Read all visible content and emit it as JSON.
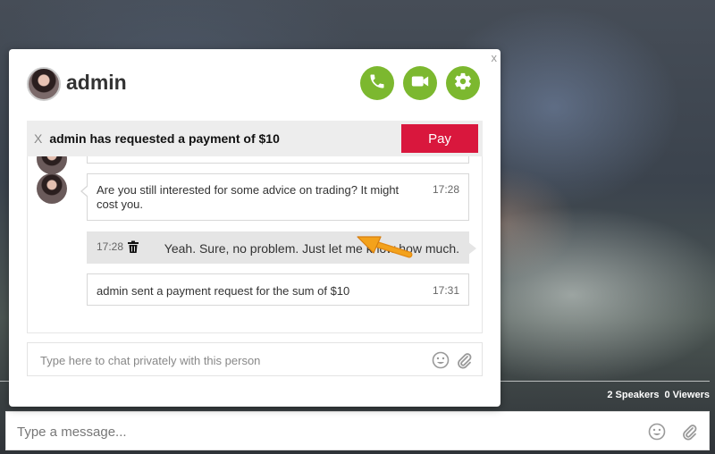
{
  "dialog": {
    "close_label": "x",
    "user_name": "admin",
    "icons": {
      "call": "phone-icon",
      "video": "video-camera-icon",
      "settings": "gear-icon"
    },
    "accent_color": "#7cb82f"
  },
  "payment_banner": {
    "dismiss_label": "X",
    "text": "admin has requested a payment of $10",
    "pay_label": "Pay",
    "pay_color": "#d9173d"
  },
  "messages": [
    {
      "direction": "incoming",
      "text": "Are you still interested for some advice on trading? It might cost you.",
      "time": "17:28"
    },
    {
      "direction": "outgoing",
      "text": "Yeah. Sure, no problem. Just let me know how much.",
      "time": "17:28"
    },
    {
      "direction": "incoming",
      "text": "admin sent a payment request for the sum of $10",
      "time": "17:31"
    }
  ],
  "private_chat": {
    "placeholder": "Type here to chat privately with this person"
  },
  "room_stats": {
    "speakers_count": "2",
    "speakers_label": "Speakers",
    "viewers_count": "0",
    "viewers_label": "Viewers"
  },
  "main_chat": {
    "placeholder": "Type a message..."
  }
}
